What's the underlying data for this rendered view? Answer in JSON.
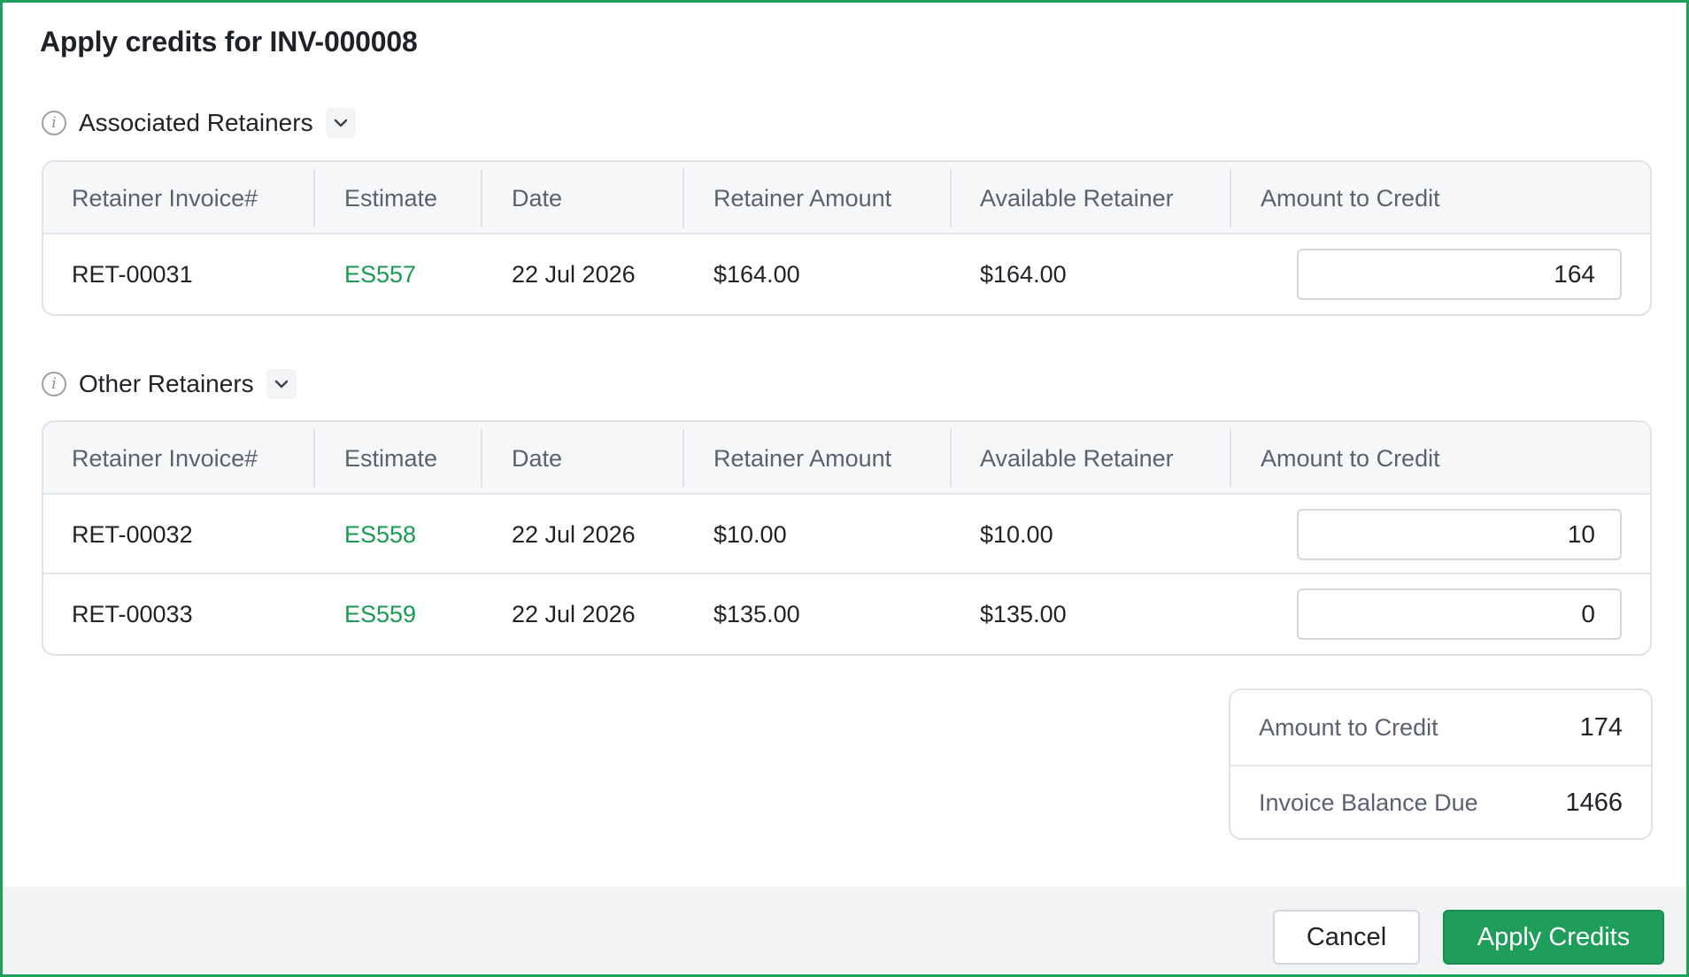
{
  "dialog": {
    "title": "Apply credits for INV-000008"
  },
  "columns": {
    "retainer_invoice": "Retainer Invoice#",
    "estimate": "Estimate",
    "date": "Date",
    "retainer_amount": "Retainer Amount",
    "available_retainer": "Available Retainer",
    "amount_to_credit": "Amount to Credit"
  },
  "associated": {
    "label": "Associated Retainers",
    "rows": [
      {
        "invoice": "RET-00031",
        "estimate": "ES557",
        "date": "22 Jul 2026",
        "retainer_amount": "$164.00",
        "available": "$164.00",
        "credit": "164"
      }
    ]
  },
  "other": {
    "label": "Other Retainers",
    "rows": [
      {
        "invoice": "RET-00032",
        "estimate": "ES558",
        "date": "22 Jul 2026",
        "retainer_amount": "$10.00",
        "available": "$10.00",
        "credit": "10"
      },
      {
        "invoice": "RET-00033",
        "estimate": "ES559",
        "date": "22 Jul 2026",
        "retainer_amount": "$135.00",
        "available": "$135.00",
        "credit": "0"
      }
    ]
  },
  "summary": {
    "amount_to_credit_label": "Amount to Credit",
    "amount_to_credit_value": "174",
    "balance_due_label": "Invoice Balance Due",
    "balance_due_value": "1466"
  },
  "footer": {
    "cancel_label": "Cancel",
    "apply_label": "Apply Credits"
  },
  "colors": {
    "accent": "#1f9d5a",
    "link": "#1a9b52",
    "border": "#1ea05c"
  },
  "icons": {
    "info": "info-icon",
    "chevron": "chevron-down-icon"
  }
}
